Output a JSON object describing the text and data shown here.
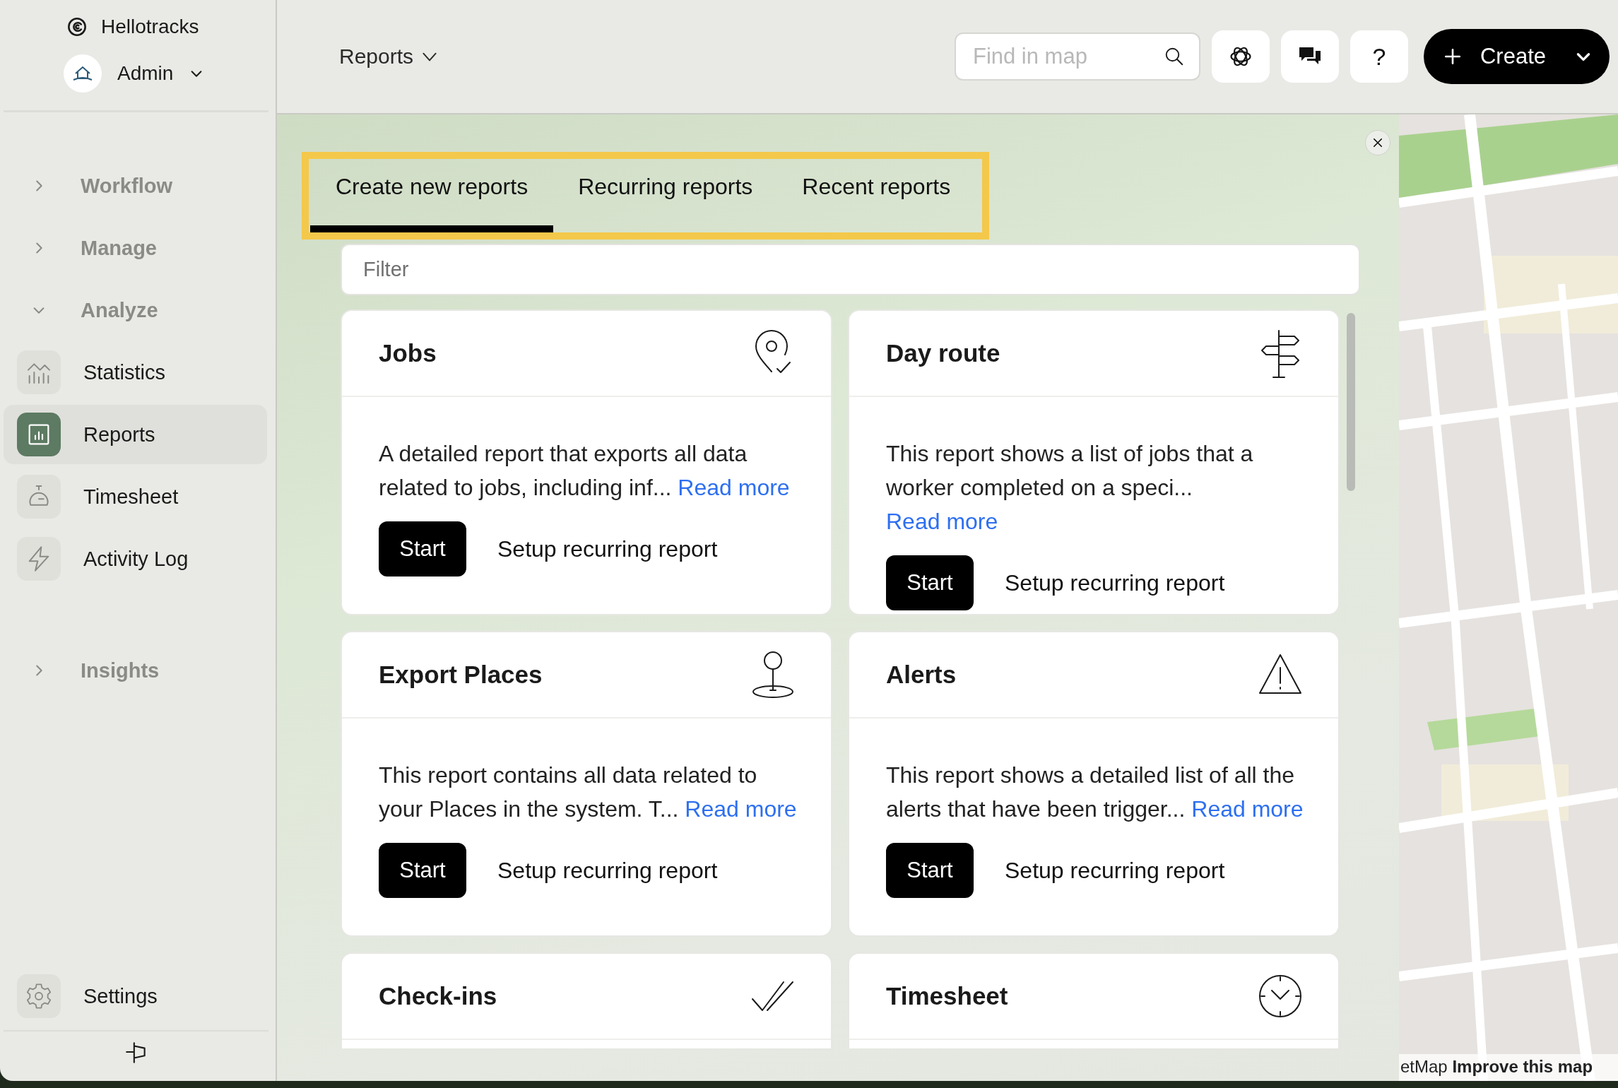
{
  "app": {
    "name": "Hellotracks"
  },
  "account": {
    "name": "Admin"
  },
  "sidebar": {
    "groups": [
      {
        "label": "Workflow",
        "expanded": false
      },
      {
        "label": "Manage",
        "expanded": false
      },
      {
        "label": "Analyze",
        "expanded": true,
        "children": [
          {
            "label": "Statistics",
            "kind": "statistics",
            "selected": false
          },
          {
            "label": "Reports",
            "kind": "reports",
            "selected": true
          },
          {
            "label": "Timesheet",
            "kind": "timesheet",
            "selected": false
          },
          {
            "label": "Activity Log",
            "kind": "activity",
            "selected": false
          }
        ]
      },
      {
        "label": "Insights",
        "expanded": false
      }
    ],
    "settings": "Settings"
  },
  "header": {
    "title": "Reports",
    "search_placeholder": "Find in map",
    "help": "?",
    "create": "Create"
  },
  "tabs": [
    {
      "label": "Create new reports",
      "selected": true
    },
    {
      "label": "Recurring reports",
      "selected": false
    },
    {
      "label": "Recent reports",
      "selected": false
    }
  ],
  "filter": {
    "placeholder": "Filter"
  },
  "reports": [
    {
      "kind": "jobs",
      "title": "Jobs",
      "description": "A detailed report that exports all data related to jobs, including inf...",
      "read_more": "Read more",
      "start": "Start",
      "recurring": "Setup recurring report"
    },
    {
      "kind": "route",
      "title": "Day route",
      "description": "This report shows a list of jobs that a worker completed on a speci...",
      "read_more": "Read more",
      "start": "Start",
      "recurring": "Setup recurring report"
    },
    {
      "kind": "places",
      "title": "Export Places",
      "description": "This report contains all data related to your Places in the system. T...",
      "read_more": "Read more",
      "start": "Start",
      "recurring": "Setup recurring report"
    },
    {
      "kind": "alerts",
      "title": "Alerts",
      "description": "This report shows a detailed list of all the alerts that have been trigger...",
      "read_more": "Read more",
      "start": "Start",
      "recurring": "Setup recurring report"
    },
    {
      "kind": "checkins",
      "title": "Check-ins"
    },
    {
      "kind": "timesheet",
      "title": "Timesheet"
    }
  ],
  "map": {
    "kind": "picture",
    "attribution": "etMap **Improve this map**"
  }
}
